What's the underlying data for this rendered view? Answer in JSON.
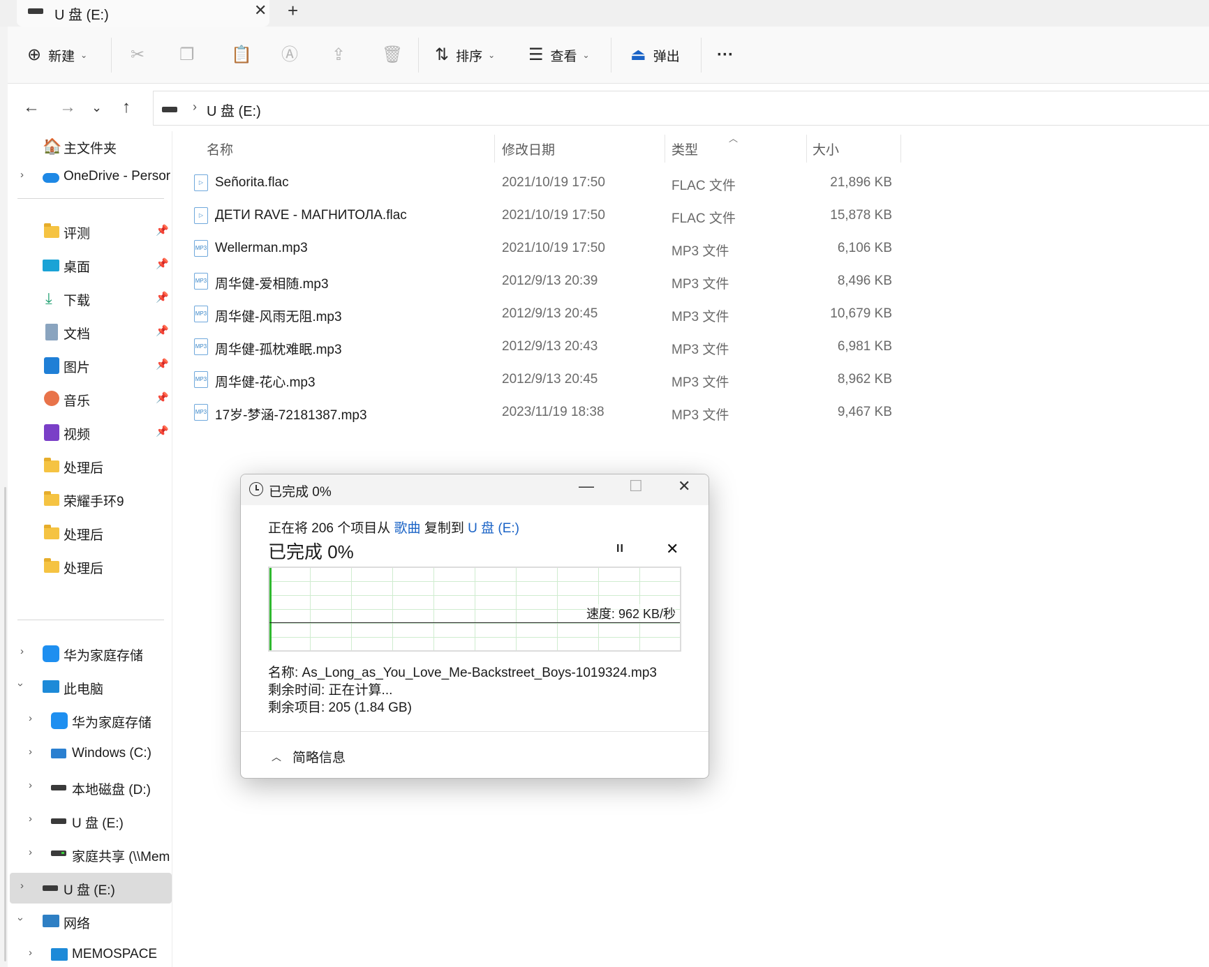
{
  "tab": {
    "title": "U 盘 (E:)",
    "close": "✕",
    "add": "+"
  },
  "toolbar": {
    "new_label": "新建",
    "sort_label": "排序",
    "view_label": "查看",
    "eject_label": "弹出",
    "more": "···"
  },
  "address": {
    "sep": "›",
    "path": "U 盘 (E:)"
  },
  "sidebar": {
    "home": "主文件夹",
    "onedrive": "OneDrive - Persor",
    "quick": [
      {
        "label": "评测",
        "icon": "folder-icon"
      },
      {
        "label": "桌面",
        "icon": "desktop-icon"
      },
      {
        "label": "下载",
        "icon": "download-icon"
      },
      {
        "label": "文档",
        "icon": "document-icon"
      },
      {
        "label": "图片",
        "icon": "pictures-icon"
      },
      {
        "label": "音乐",
        "icon": "music-icon"
      },
      {
        "label": "视频",
        "icon": "video-icon"
      },
      {
        "label": "处理后",
        "icon": "folder-icon"
      },
      {
        "label": "荣耀手环9",
        "icon": "folder-icon"
      },
      {
        "label": "处理后",
        "icon": "folder-icon"
      },
      {
        "label": "处理后",
        "icon": "folder-icon"
      }
    ],
    "huawei": "华为家庭存储",
    "thispc": "此电脑",
    "pc_children": [
      {
        "label": "华为家庭存储"
      },
      {
        "label": "Windows (C:)"
      },
      {
        "label": "本地磁盘 (D:)"
      },
      {
        "label": "U 盘 (E:)"
      },
      {
        "label": "家庭共享 (\\\\Mem"
      }
    ],
    "usb": "U 盘 (E:)",
    "network": "网络",
    "memospace": "MEMOSPACE"
  },
  "columns": {
    "name": "名称",
    "date": "修改日期",
    "type": "类型",
    "size": "大小"
  },
  "files": [
    {
      "name": "Señorita.flac",
      "date": "2021/10/19 17:50",
      "type": "FLAC 文件",
      "size": "21,896 KB",
      "kind": "flac"
    },
    {
      "name": "ДЕТИ RAVE - МАГНИТОЛА.flac",
      "date": "2021/10/19 17:50",
      "type": "FLAC 文件",
      "size": "15,878 KB",
      "kind": "flac"
    },
    {
      "name": "Wellerman.mp3",
      "date": "2021/10/19 17:50",
      "type": "MP3 文件",
      "size": "6,106 KB",
      "kind": "mp3"
    },
    {
      "name": "周华健-爱相随.mp3",
      "date": "2012/9/13 20:39",
      "type": "MP3 文件",
      "size": "8,496 KB",
      "kind": "mp3"
    },
    {
      "name": "周华健-风雨无阻.mp3",
      "date": "2012/9/13 20:45",
      "type": "MP3 文件",
      "size": "10,679 KB",
      "kind": "mp3"
    },
    {
      "name": "周华健-孤枕难眠.mp3",
      "date": "2012/9/13 20:43",
      "type": "MP3 文件",
      "size": "6,981 KB",
      "kind": "mp3"
    },
    {
      "name": "周华健-花心.mp3",
      "date": "2012/9/13 20:45",
      "type": "MP3 文件",
      "size": "8,962 KB",
      "kind": "mp3"
    },
    {
      "name": "17岁-梦涵-72181387.mp3",
      "date": "2023/11/19 18:38",
      "type": "MP3 文件",
      "size": "9,467 KB",
      "kind": "mp3"
    }
  ],
  "dialog": {
    "title": "已完成 0%",
    "line_prefix": "正在将 206 个项目从 ",
    "source": "歌曲",
    "line_mid": " 复制到 ",
    "dest": "U 盘 (E:)",
    "heading": "已完成 0%",
    "progress_fraction": 0.0,
    "speed": "速度: 962 KB/秒",
    "name_line": "名称:  As_Long_as_You_Love_Me-Backstreet_Boys-1019324.mp3",
    "time_line": "剩余时间:  正在计算...",
    "items_line": "剩余项目:  205 (1.84 GB)",
    "less_details": "简略信息",
    "pause": "II",
    "stop": "✕",
    "minimize": "—",
    "maximize": "☐",
    "close": "✕"
  },
  "colors": {
    "accent": "#1a63c6",
    "progress": "#2fb82f",
    "grid": "#cfeccf"
  }
}
